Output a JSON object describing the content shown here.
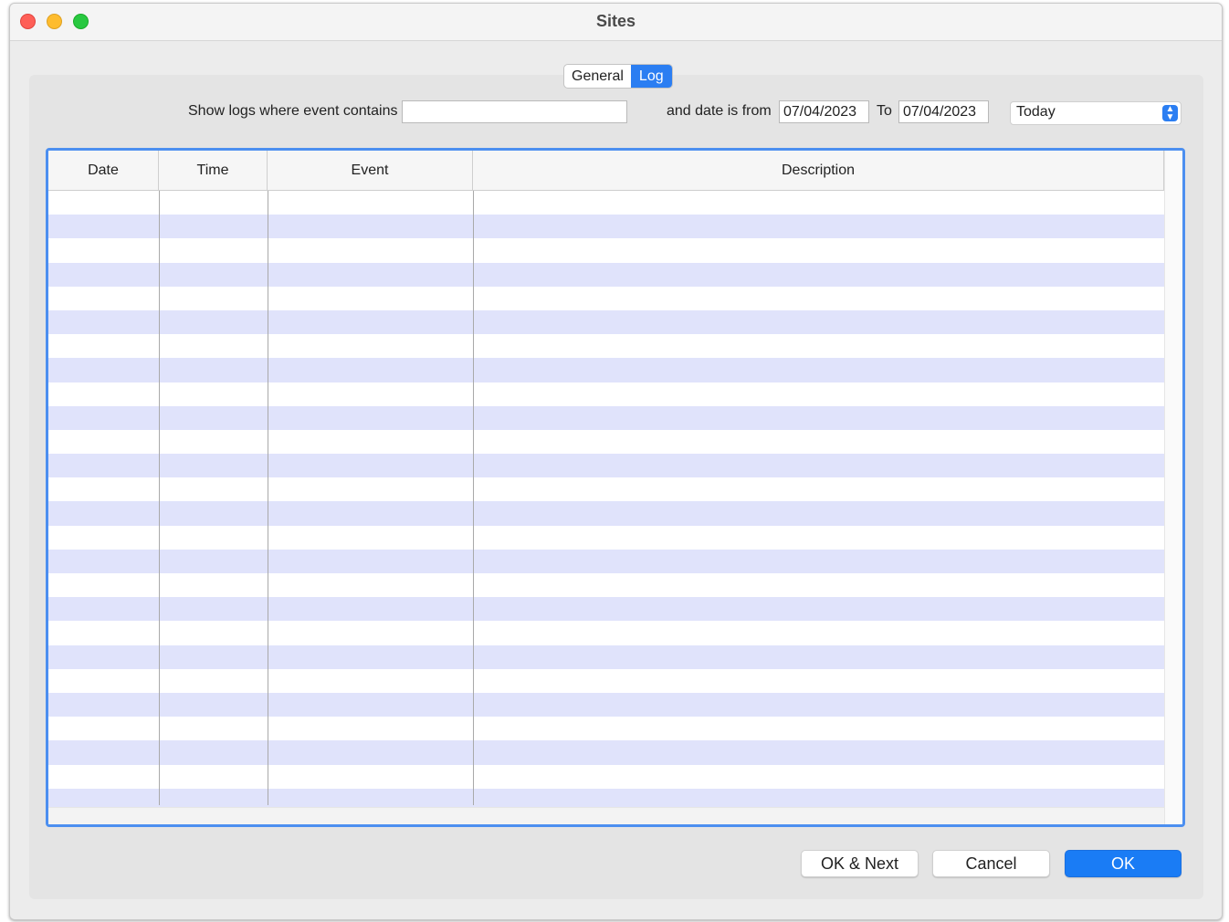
{
  "window": {
    "title": "Sites"
  },
  "tabs": [
    {
      "label": "General",
      "active": false
    },
    {
      "label": "Log",
      "active": true
    }
  ],
  "filter": {
    "event_label": "Show logs where event contains",
    "event_value": "",
    "date_label": "and date is from",
    "date_from": "07/04/2023",
    "to_label": "To",
    "date_to": "07/04/2023",
    "range_selected": "Today"
  },
  "table": {
    "columns": [
      "Date",
      "Time",
      "Event",
      "Description"
    ],
    "rows": []
  },
  "buttons": {
    "ok_next": "OK & Next",
    "cancel": "Cancel",
    "ok": "OK"
  },
  "colors": {
    "accent": "#2b7ef2",
    "row_stripe": "#e0e3fb",
    "table_focus_border": "#4c8ff0"
  },
  "icons": {
    "select_arrow": "updown-chevron-icon"
  }
}
